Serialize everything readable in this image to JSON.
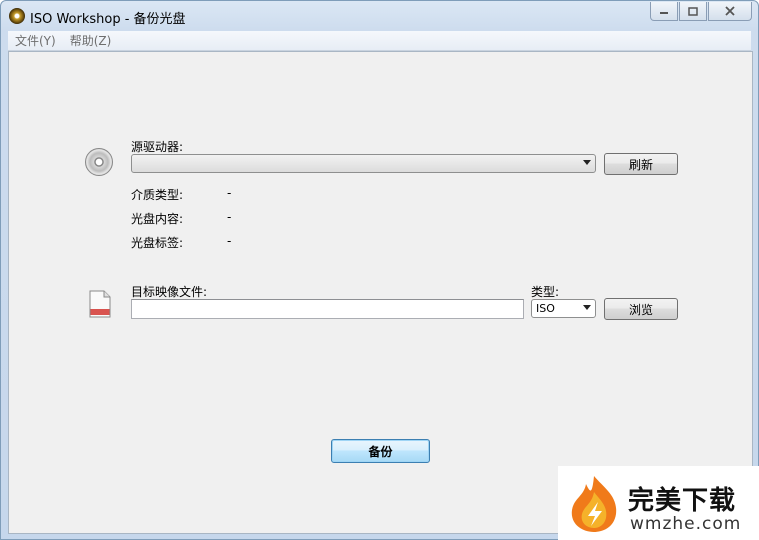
{
  "window": {
    "title": "ISO Workshop - 备份光盘"
  },
  "menu": {
    "items": [
      {
        "label": "文件(Y)"
      },
      {
        "label": "帮助(Z)"
      }
    ]
  },
  "source": {
    "label": "源驱动器:",
    "selected": "",
    "refresh_label": "刷新",
    "media_type_label": "介质类型:",
    "media_type_value": "-",
    "disc_content_label": "光盘内容:",
    "disc_content_value": "-",
    "disc_label_label": "光盘标签:",
    "disc_label_value": "-"
  },
  "target": {
    "label": "目标映像文件:",
    "file_value": "",
    "type_label": "类型:",
    "type_value": "ISO",
    "browse_label": "浏览"
  },
  "actions": {
    "backup_label": "备份"
  },
  "watermark": {
    "title": "完美下载",
    "url": "wmzhe.com"
  }
}
